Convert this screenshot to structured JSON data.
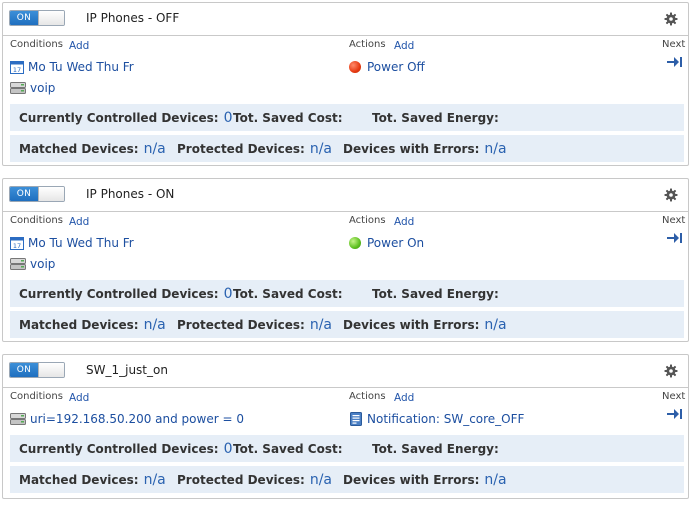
{
  "common": {
    "toggle_on": "ON",
    "conditions_label": "Conditions",
    "actions_label": "Actions",
    "next_label": "Next",
    "add_label": "Add",
    "stats": {
      "controlled_label": "Currently Controlled Devices:",
      "controlled_value": "0",
      "saved_cost_label": "Tot. Saved Cost:",
      "saved_energy_label": "Tot. Saved Energy:",
      "matched_label": "Matched Devices:",
      "matched_value": "n/a",
      "protected_label": "Protected Devices:",
      "protected_value": "n/a",
      "errors_label": "Devices with Errors:",
      "errors_value": "n/a"
    }
  },
  "rules": [
    {
      "title": "IP Phones - OFF",
      "conditions": [
        {
          "icon": "calendar-icon",
          "text": "Mo Tu Wed Thu Fr"
        },
        {
          "icon": "device-icon",
          "text": "voip"
        }
      ],
      "action": {
        "icon": "red-status-icon",
        "text": "Power Off",
        "color": "#e63a12"
      }
    },
    {
      "title": "IP Phones - ON",
      "conditions": [
        {
          "icon": "calendar-icon",
          "text": "Mo Tu Wed Thu Fr"
        },
        {
          "icon": "device-icon",
          "text": "voip"
        }
      ],
      "action": {
        "icon": "green-status-icon",
        "text": "Power On",
        "color": "#5cbf1e"
      }
    },
    {
      "title": "SW_1_just_on",
      "conditions": [
        {
          "icon": "device-icon",
          "text": "uri=192.168.50.200 and power = 0"
        }
      ],
      "action": {
        "icon": "notification-icon",
        "text": "Notification: SW_core_OFF"
      }
    }
  ]
}
